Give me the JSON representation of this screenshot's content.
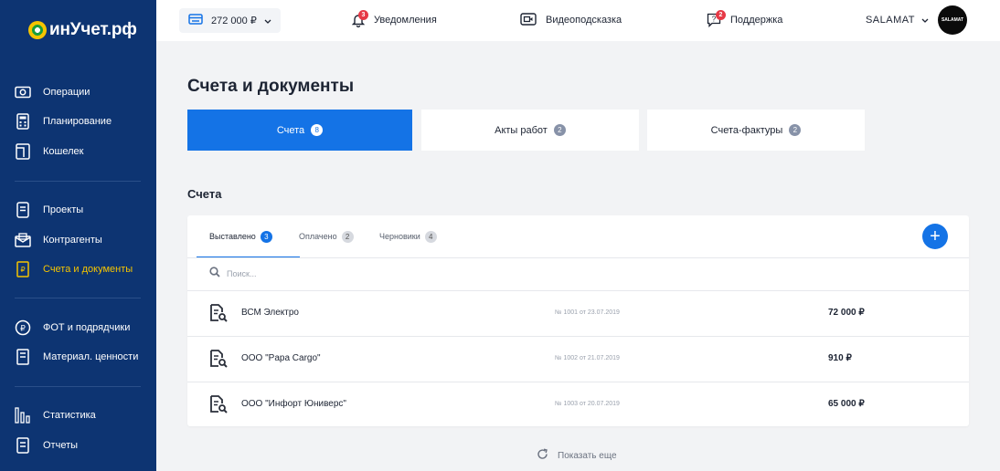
{
  "brand": {
    "logo_text": "инУчет.рф"
  },
  "sidebar": {
    "items": [
      {
        "label": "Операции",
        "icon": "money-icon"
      },
      {
        "label": "Планирование",
        "icon": "calculator-icon"
      },
      {
        "label": "Кошелек",
        "icon": "wallet-icon"
      },
      {
        "label": "Проекты",
        "icon": "folder-icon"
      },
      {
        "label": "Контрагенты",
        "icon": "contacts-icon"
      },
      {
        "label": "Счета и документы",
        "icon": "invoice-icon",
        "active": true
      },
      {
        "label": "ФОТ и подрядчики",
        "icon": "ruble-icon"
      },
      {
        "label": "Материал. ценности",
        "icon": "box-icon"
      },
      {
        "label": "Статистика",
        "icon": "bar-chart-icon"
      },
      {
        "label": "Отчеты",
        "icon": "report-icon"
      }
    ]
  },
  "topbar": {
    "balance": "272 000 ₽",
    "notifications": {
      "label": "Уведомления",
      "count": "3"
    },
    "video_hint": {
      "label": "Видеоподсказка"
    },
    "support": {
      "label": "Поддержка",
      "count": "2"
    },
    "user_name": "SALAMAT",
    "avatar_text": "SALAMAT"
  },
  "page": {
    "title": "Счета и документы",
    "doc_tabs": [
      {
        "label": "Счета",
        "count": "8",
        "active": true
      },
      {
        "label": "Акты работ",
        "count": "2"
      },
      {
        "label": "Счета-фактуры",
        "count": "2"
      }
    ],
    "section_title": "Счета",
    "subtabs": [
      {
        "label": "Выставлено",
        "count": "3",
        "active": true
      },
      {
        "label": "Оплачено",
        "count": "2"
      },
      {
        "label": "Черновики",
        "count": "4"
      }
    ],
    "add_label": "+",
    "search_placeholder": "Поиск...",
    "rows": [
      {
        "name": "ВСМ Электро",
        "number": "№ 1001 от 23.07.2019",
        "amount": "72 000 ₽"
      },
      {
        "name": "ООО \"Papa Cargo\"",
        "number": "№ 1002 от 21.07.2019",
        "amount": "910 ₽"
      },
      {
        "name": "ООО \"Инфорт Юниверс\"",
        "number": "№ 1003 от 20.07.2019",
        "amount": "65 000 ₽"
      }
    ],
    "show_more": "Показать еще"
  },
  "colors": {
    "sidebar_bg": "#0d3472",
    "accent": "#1473e6",
    "active_nav": "#f5c400",
    "badge": "#e63946"
  }
}
